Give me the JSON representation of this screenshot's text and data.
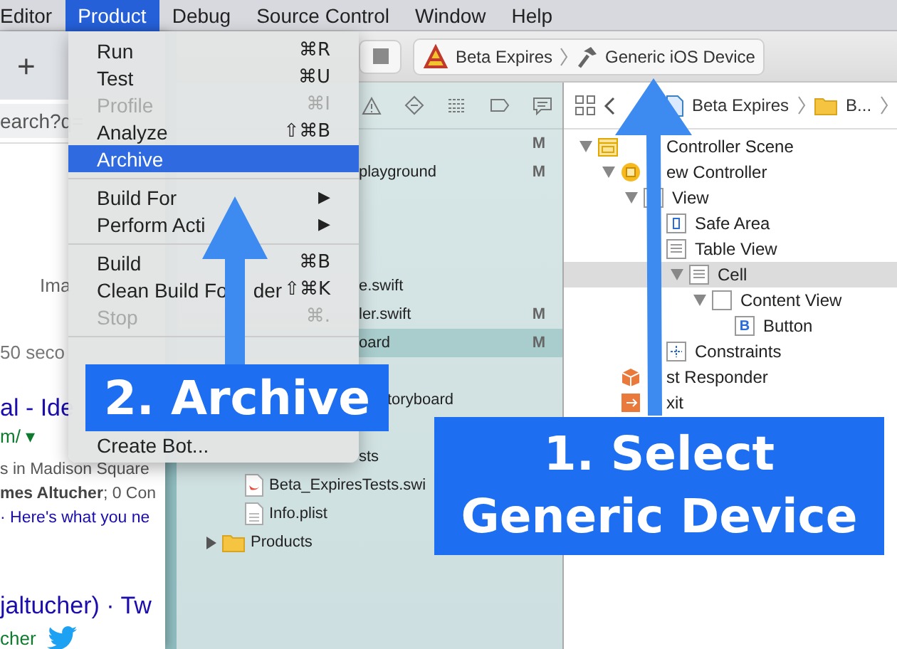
{
  "menu_bar": [
    {
      "label": "Editor",
      "selected": false
    },
    {
      "label": "Product",
      "selected": true
    },
    {
      "label": "Debug",
      "selected": false
    },
    {
      "label": "Source Control",
      "selected": false
    },
    {
      "label": "Window",
      "selected": false
    },
    {
      "label": "Help",
      "selected": false
    }
  ],
  "browser": {
    "new_tab": "+",
    "address": "earch?q=",
    "texts": [
      {
        "kind": "tab",
        "text": "Ima"
      },
      {
        "kind": "meta",
        "text": "50 seco"
      },
      {
        "kind": "title",
        "text": "al - Ide"
      },
      {
        "kind": "url",
        "text": "m/ ▾"
      },
      {
        "kind": "snippet",
        "text": "s in Madison Square"
      },
      {
        "kind": "snippet",
        "text": "**mes Altucher**; 0 Con"
      },
      {
        "kind": "link",
        "text": "· Here's what you ne"
      },
      {
        "kind": "title",
        "text": "jaltucher) · Tw"
      },
      {
        "kind": "account",
        "text": "cher"
      }
    ]
  },
  "toolbar": {
    "scheme": "Beta Expires",
    "destination": "Generic iOS Device"
  },
  "navigator": {
    "rows": [
      {
        "kind": "clipped",
        "badge": "M",
        "selected": false
      },
      {
        "kind": "clipped",
        "name": "playground",
        "badge": "M",
        "selected": false
      },
      {
        "kind": "clipped",
        "name": "e.swift",
        "selected": false
      },
      {
        "kind": "clipped",
        "name": "ler.swift",
        "badge": "M",
        "selected": false
      },
      {
        "kind": "clipped",
        "name": "oard",
        "badge": "M",
        "selected": true
      },
      {
        "kind": "clipped",
        "name": "toryboard",
        "selected": false
      },
      {
        "kind": "clipped",
        "name": "sts",
        "selected": false
      },
      {
        "kind": "swift",
        "name": "Beta_ExpiresTests.swi",
        "selected": false
      },
      {
        "kind": "plist",
        "name": "Info.plist",
        "selected": false
      },
      {
        "kind": "folder",
        "name": "Products",
        "expanded": false,
        "selected": false
      }
    ]
  },
  "outline": {
    "jump_bar": [
      "Beta Expires",
      "B..."
    ],
    "tree": [
      {
        "kind": "scene",
        "name": "Controller Scene",
        "expanded": true,
        "selected": false,
        "children": [
          {
            "kind": "controller",
            "name": "ew Controller",
            "expanded": true,
            "selected": false,
            "children": [
              {
                "kind": "view",
                "name": "View",
                "expanded": true,
                "selected": false,
                "children": [
                  {
                    "kind": "safe-area",
                    "name": "Safe Area",
                    "selected": false
                  },
                  {
                    "kind": "table",
                    "name": "Table View",
                    "selected": false,
                    "children": [
                      {
                        "kind": "cell",
                        "name": "Cell",
                        "expanded": true,
                        "selected": true,
                        "children": [
                          {
                            "kind": "view",
                            "name": "Content View",
                            "expanded": true,
                            "selected": false,
                            "children": [
                              {
                                "kind": "button",
                                "name": "Button",
                                "icon_text": "B",
                                "selected": false
                              }
                            ]
                          }
                        ]
                      }
                    ]
                  },
                  {
                    "kind": "constraints",
                    "name": "Constraints",
                    "selected": false
                  }
                ]
              }
            ]
          },
          {
            "kind": "responder",
            "name": "st Responder",
            "selected": false
          },
          {
            "kind": "exit",
            "name": "xit",
            "selected": false
          }
        ]
      }
    ]
  },
  "product_menu": {
    "sections": [
      [
        {
          "label": "Run",
          "shortcut": "⌘R",
          "disabled": false,
          "selected": false
        },
        {
          "label": "Test",
          "shortcut": "⌘U",
          "disabled": false,
          "selected": false
        },
        {
          "label": "Profile",
          "shortcut": "⌘I",
          "disabled": true,
          "selected": false
        },
        {
          "label": "Analyze",
          "shortcut": "⇧⌘B",
          "disabled": false,
          "selected": false
        },
        {
          "label": "Archive",
          "disabled": false,
          "selected": true
        }
      ],
      [
        {
          "label": "Build For",
          "submenu": "▶",
          "disabled": false,
          "selected": false
        },
        {
          "label": "Perform Acti",
          "submenu": "▶",
          "disabled": false,
          "selected": false
        }
      ],
      [
        {
          "label": "Build",
          "shortcut": "⌘B",
          "disabled": false,
          "selected": false
        },
        {
          "label": "Clean Build Fo",
          "label_tail": "der",
          "shortcut": "⇧⌘K",
          "disabled": false,
          "selected": false
        },
        {
          "label": "Stop",
          "shortcut": "⌘.",
          "disabled": true,
          "selected": false
        }
      ],
      [
        {
          "label": "Create Bot...",
          "disabled": false,
          "selected": false
        }
      ]
    ]
  },
  "callouts": [
    {
      "lines": [
        "2. Archive"
      ]
    },
    {
      "lines": [
        "1. Select",
        "Generic Device"
      ]
    }
  ]
}
